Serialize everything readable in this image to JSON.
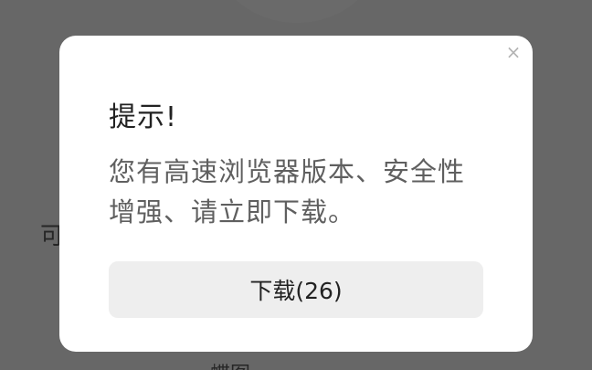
{
  "background": {
    "left_text": "可",
    "bottom_text": "蝶图"
  },
  "dialog": {
    "close_icon": "×",
    "title": "提示!",
    "message": "您有高速浏览器版本、安全性增强、请立即下载。",
    "download_label": "下载(26)"
  },
  "colors": {
    "overlay": "#4a4a4a",
    "dialog_bg": "#ffffff",
    "button_bg": "#eeeeee",
    "title_text": "#222222",
    "body_text": "#5f5f5f",
    "close_icon": "#b4b4b4"
  }
}
